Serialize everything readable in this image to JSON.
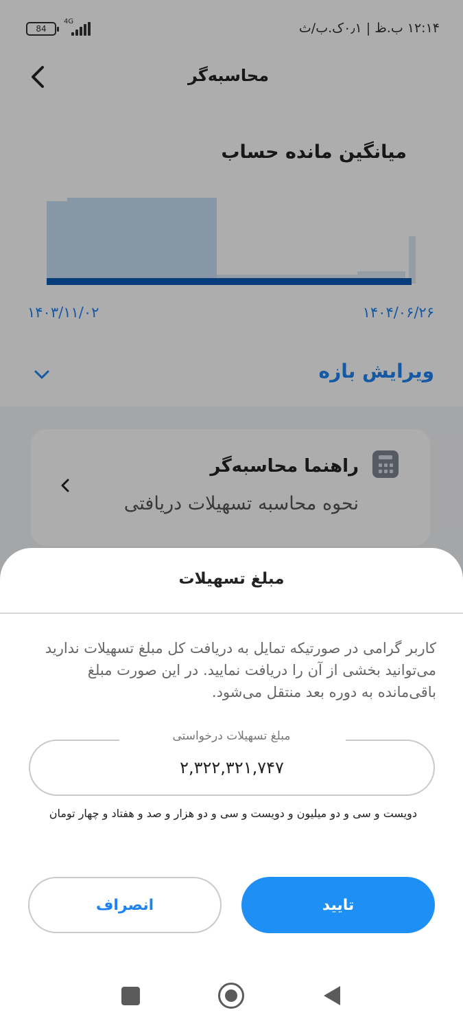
{
  "status_bar": {
    "time": "۱۲:۱۴ ب.ظ | ۰٫۱ک.ب/ث",
    "battery": "84",
    "network": "4G"
  },
  "header": {
    "title": "محاسبه‌گر"
  },
  "chart_section": {
    "title": "میانگین مانده حساب",
    "date_start": "۱۴۰۳/۱۱/۰۲",
    "date_end": "۱۴۰۴/۰۶/۲۶",
    "edit_range_label": "ویرایش بازه"
  },
  "guide": {
    "title": "راهنما محاسبه‌گر",
    "subtitle": "نحوه محاسبه تسهیلات دریافتی"
  },
  "sheet": {
    "title": "مبلغ تسهیلات",
    "description": "کاربر گرامی در صورتیکه تمایل به دریافت کل مبلغ تسهیلات ندارید می‌توانید بخشی از آن را دریافت نمایید. در این صورت مبلغ باقی‌مانده به دوره بعد منتقل می‌شود.",
    "amount_label": "مبلغ تسهیلات درخواستی",
    "amount_value": "۲,۳۲۲,۳۲۱,۷۴۷",
    "amount_words": "دویست و سی و دو میلیون و دویست و سی و دو هزار و صد و هفتاد و چهار تومان",
    "cancel_label": "انصراف",
    "confirm_label": "تایید"
  },
  "colors": {
    "accent": "#1e8ff4",
    "chart_line": "#0d5bb5",
    "chart_fill": "#c9dff3"
  }
}
